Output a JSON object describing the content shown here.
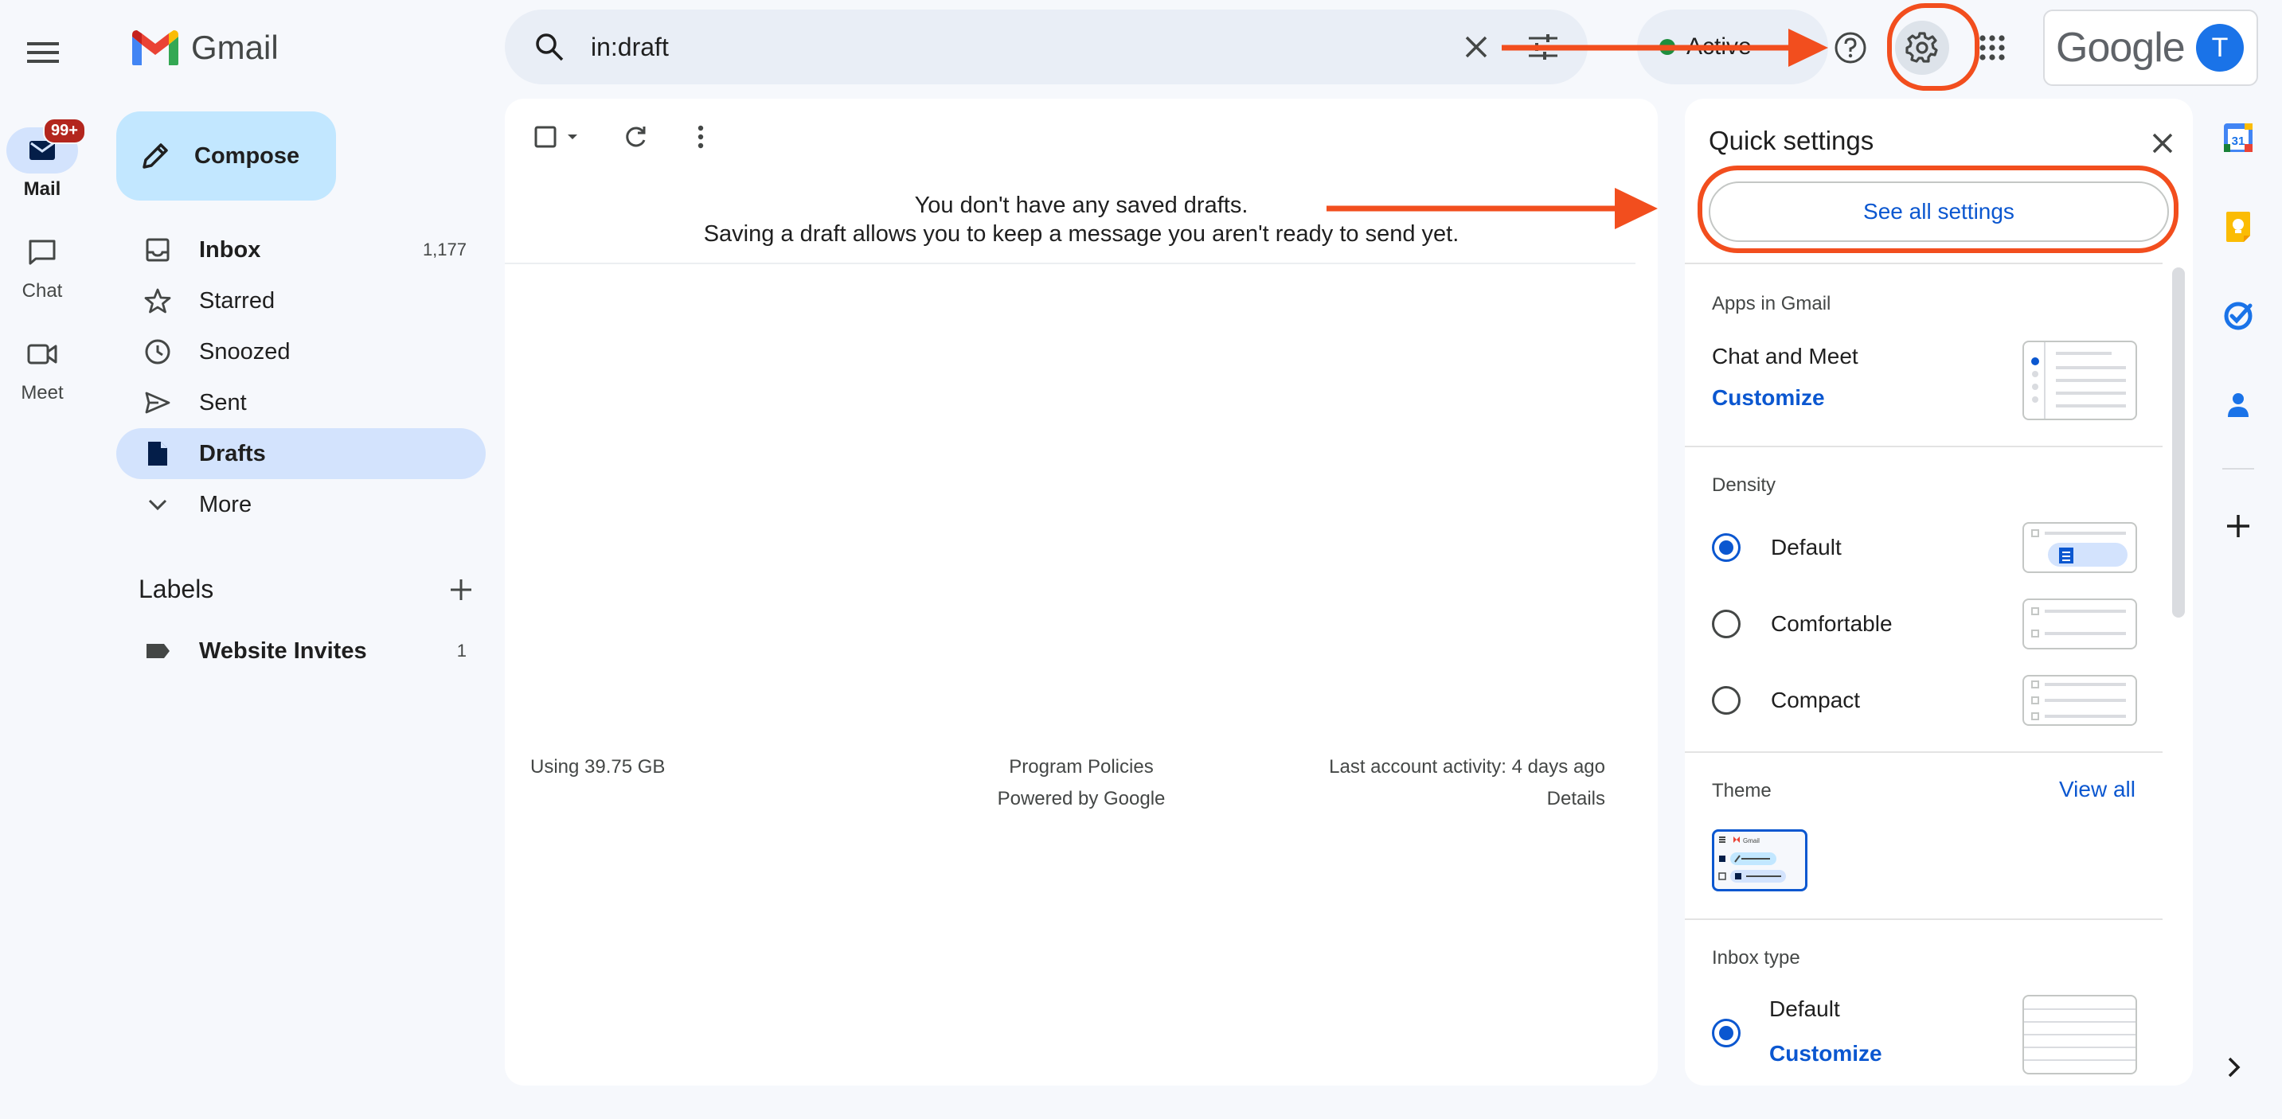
{
  "app": {
    "name": "Gmail"
  },
  "rail": {
    "items": [
      {
        "label": "Mail",
        "badge": "99+"
      },
      {
        "label": "Chat"
      },
      {
        "label": "Meet"
      }
    ]
  },
  "compose": {
    "label": "Compose"
  },
  "nav": {
    "items": [
      {
        "label": "Inbox",
        "count": "1,177"
      },
      {
        "label": "Starred"
      },
      {
        "label": "Snoozed"
      },
      {
        "label": "Sent"
      },
      {
        "label": "Drafts"
      },
      {
        "label": "More"
      }
    ]
  },
  "labels": {
    "title": "Labels",
    "items": [
      {
        "label": "Website Invites",
        "count": "1"
      }
    ]
  },
  "search": {
    "value": "in:draft"
  },
  "status": {
    "label": "Active"
  },
  "account": {
    "brand": "Google",
    "initial": "T"
  },
  "main": {
    "empty_line1": "You don't have any saved drafts.",
    "empty_line2": "Saving a draft allows you to keep a message you aren't ready to send yet.",
    "storage": "Using 39.75 GB",
    "policies": "Program Policies",
    "powered": "Powered by Google",
    "activity": "Last account activity: 4 days ago",
    "details": "Details"
  },
  "quick_settings": {
    "title": "Quick settings",
    "see_all": "See all settings",
    "apps_title": "Apps in Gmail",
    "apps_item": "Chat and Meet",
    "apps_customize": "Customize",
    "density_title": "Density",
    "density_options": [
      "Default",
      "Comfortable",
      "Compact"
    ],
    "density_selected": "Default",
    "theme_title": "Theme",
    "theme_view_all": "View all",
    "theme_thumb_label": "Gmail",
    "inbox_type_title": "Inbox type",
    "inbox_type_value": "Default",
    "inbox_type_customize": "Customize"
  },
  "side_apps": {
    "calendar_day": "31"
  },
  "colors": {
    "accent": "#0b57d0",
    "nav_active": "#d3e3fd",
    "compose_bg": "#c2e7ff",
    "annotation": "#f24e1e",
    "badge": "#b3261e"
  }
}
